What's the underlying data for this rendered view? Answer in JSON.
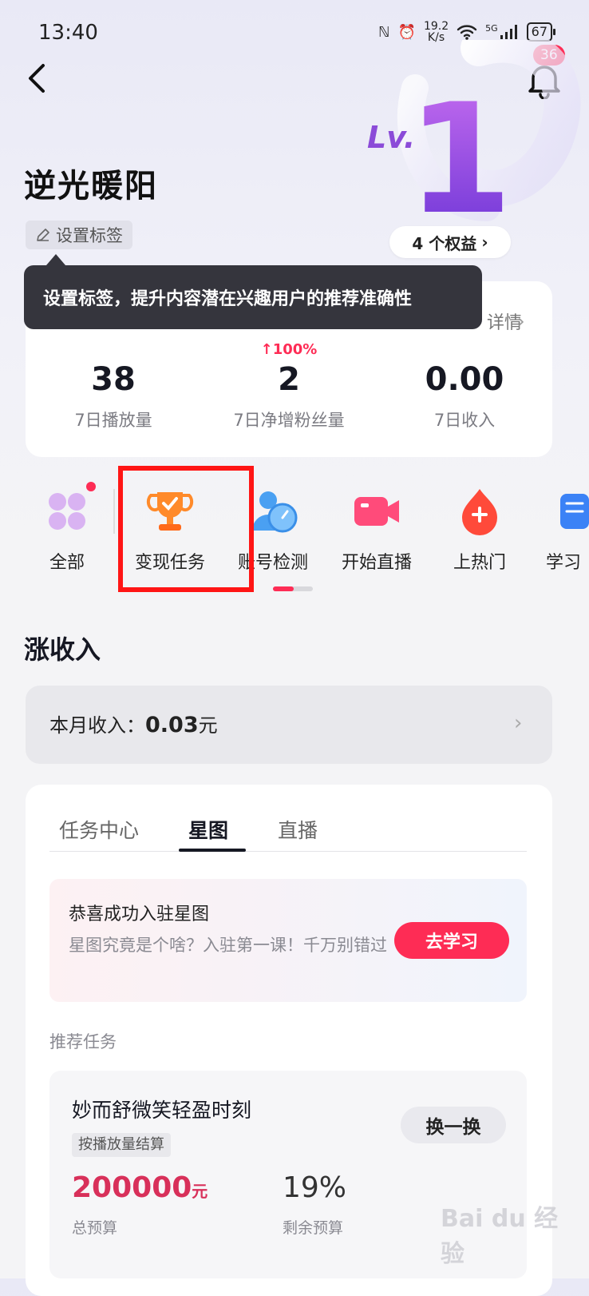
{
  "status_bar": {
    "time": "13:40",
    "net_speed_value": "19.2",
    "net_speed_unit": "K/s",
    "network": "5G",
    "battery": "67"
  },
  "header": {
    "notification_count": "36",
    "level_label": "Lv.",
    "level_number": "1"
  },
  "profile": {
    "name": "逆光暖阳",
    "tag_button": "设置标签",
    "rights_button": "4 个权益"
  },
  "tooltip": {
    "text": "设置标签，提升内容潜在兴趣用户的推荐准确性"
  },
  "stats": {
    "details_link_partial": "详情",
    "growth": "↑100%",
    "items": [
      {
        "value": "38",
        "label": "7日播放量"
      },
      {
        "value": "2",
        "label": "7日净增粉丝量"
      },
      {
        "value": "0.00",
        "label": "7日收入"
      }
    ]
  },
  "tools": [
    {
      "label": "全部",
      "icon": "grid-icon"
    },
    {
      "label": "变现任务",
      "icon": "trophy-icon"
    },
    {
      "label": "账号检测",
      "icon": "account-check-icon"
    },
    {
      "label": "开始直播",
      "icon": "video-camera-icon"
    },
    {
      "label": "上热门",
      "icon": "flame-icon"
    },
    {
      "label": "学习",
      "icon": "book-icon"
    }
  ],
  "income": {
    "section_title": "涨收入",
    "month_label": "本月收入：",
    "month_value": "0.03",
    "month_unit": "元"
  },
  "tasks": {
    "tabs": [
      "任务中心",
      "星图",
      "直播"
    ],
    "active_tab": "星图",
    "promo": {
      "title": "恭喜成功入驻星图",
      "desc": "星图究竟是个啥？入驻第一课！千万别错过",
      "button": "去学习"
    },
    "recommended_label": "推荐任务",
    "card": {
      "title": "妙而舒微笑轻盈时刻",
      "swap_button": "换一换",
      "tag": "按播放量结算",
      "budget_value": "200000",
      "budget_unit": "元",
      "budget_label": "总预算",
      "remain_value": "19%",
      "remain_label": "剩余预算"
    }
  },
  "watermark": {
    "text": "Bai du 经验"
  },
  "colors": {
    "accent": "#fe2c55",
    "highlight_box": "#ff1515",
    "budget": "#d8305a"
  }
}
